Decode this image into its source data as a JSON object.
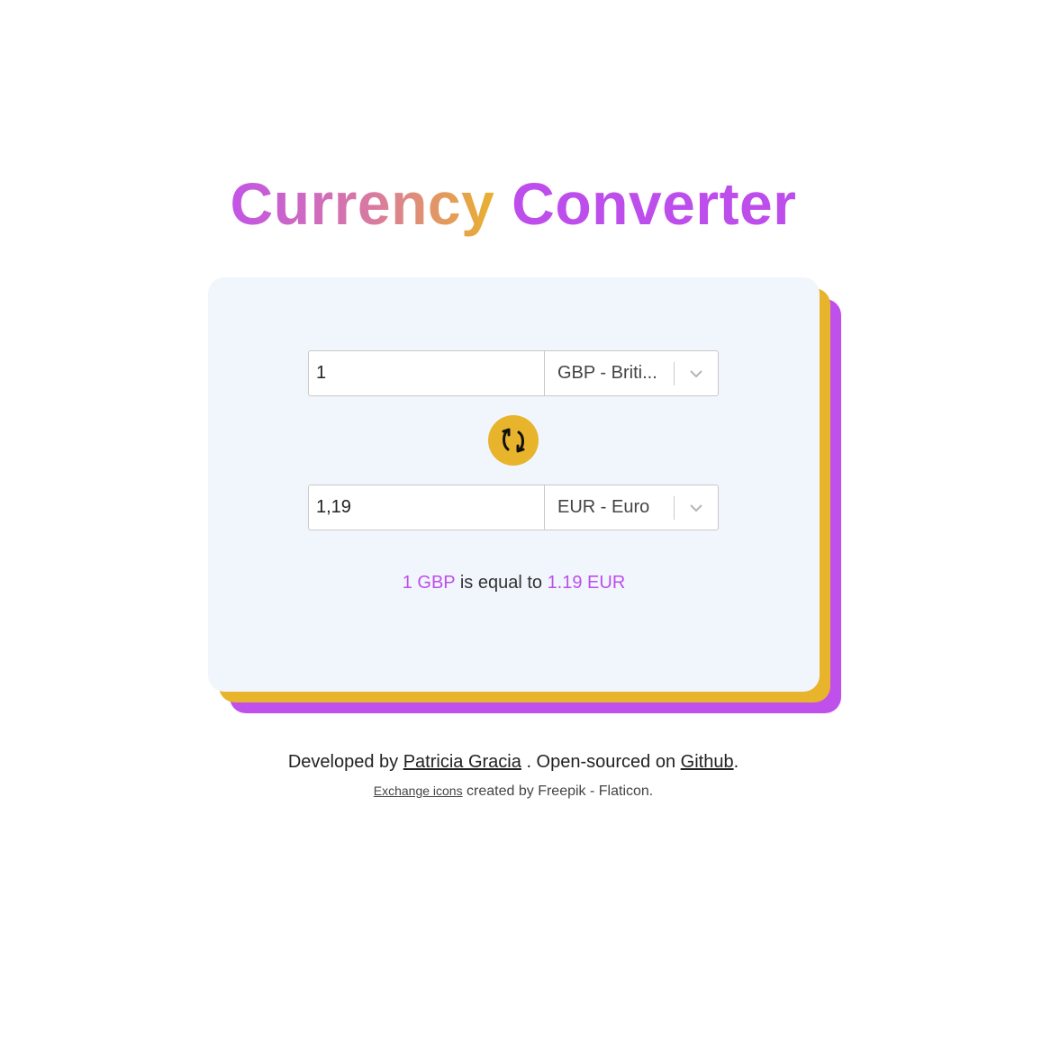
{
  "header": {
    "title_word1": "Currency",
    "title_word2": "Converter"
  },
  "converter": {
    "from": {
      "amount": "1",
      "currency_label": "GBP - Briti..."
    },
    "to": {
      "amount": "1,19",
      "currency_label": "EUR - Euro"
    },
    "swap_icon": "exchange-arrows-icon",
    "result": {
      "from_value": "1 GBP",
      "middle_text": "is equal to",
      "to_value": "1.19 EUR"
    }
  },
  "footer": {
    "developed_by": "Developed by",
    "author_link": "Patricia Gracia",
    "open_sourced": ". Open-sourced on",
    "github_link": "Github",
    "period": ".",
    "icons_link": "Exchange icons",
    "icons_credit": "created by Freepik - Flaticon."
  },
  "colors": {
    "accent_purple": "#bd4eec",
    "accent_yellow": "#e8b42c",
    "card_background": "#f1f6fd"
  }
}
